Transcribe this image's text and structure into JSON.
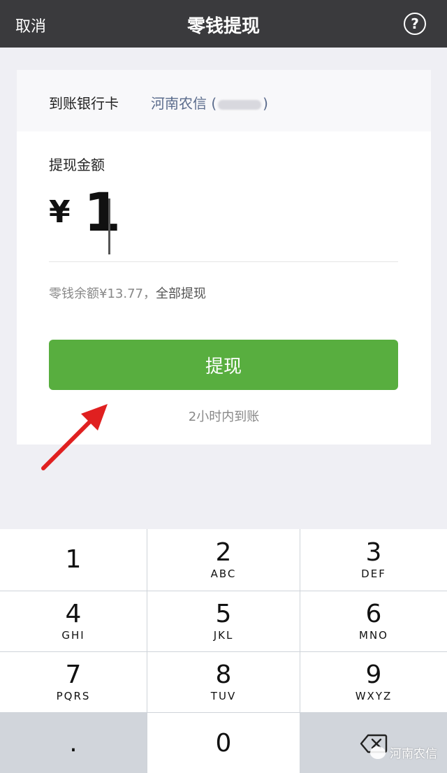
{
  "nav": {
    "cancel_label": "取消",
    "title": "零钱提现",
    "help_symbol": "?"
  },
  "bank": {
    "label": "到账银行卡",
    "name": "河南农信 (",
    "name_suffix": ")"
  },
  "amount": {
    "label": "提现金额",
    "currency": "¥",
    "value": "1"
  },
  "balance": {
    "text": "零钱余额¥13.77，",
    "withdraw_all": "全部提现"
  },
  "withdraw_button": {
    "label": "提现"
  },
  "arrival_note": "2小时内到账",
  "keypad": [
    {
      "num": "1",
      "letters": ""
    },
    {
      "num": "2",
      "letters": "ABC"
    },
    {
      "num": "3",
      "letters": "DEF"
    },
    {
      "num": "4",
      "letters": "GHI"
    },
    {
      "num": "5",
      "letters": "JKL"
    },
    {
      "num": "6",
      "letters": "MNO"
    },
    {
      "num": "7",
      "letters": "PQRS"
    },
    {
      "num": "8",
      "letters": "TUV"
    },
    {
      "num": "9",
      "letters": "WXYZ"
    },
    {
      "num": "0",
      "letters": ""
    }
  ],
  "keypad_dot": ".",
  "watermark": "河南农信",
  "colors": {
    "navbar": "#3a3a3d",
    "button": "#58ae3f",
    "arrow": "#e02020",
    "bank_name": "#5a6b8c"
  }
}
